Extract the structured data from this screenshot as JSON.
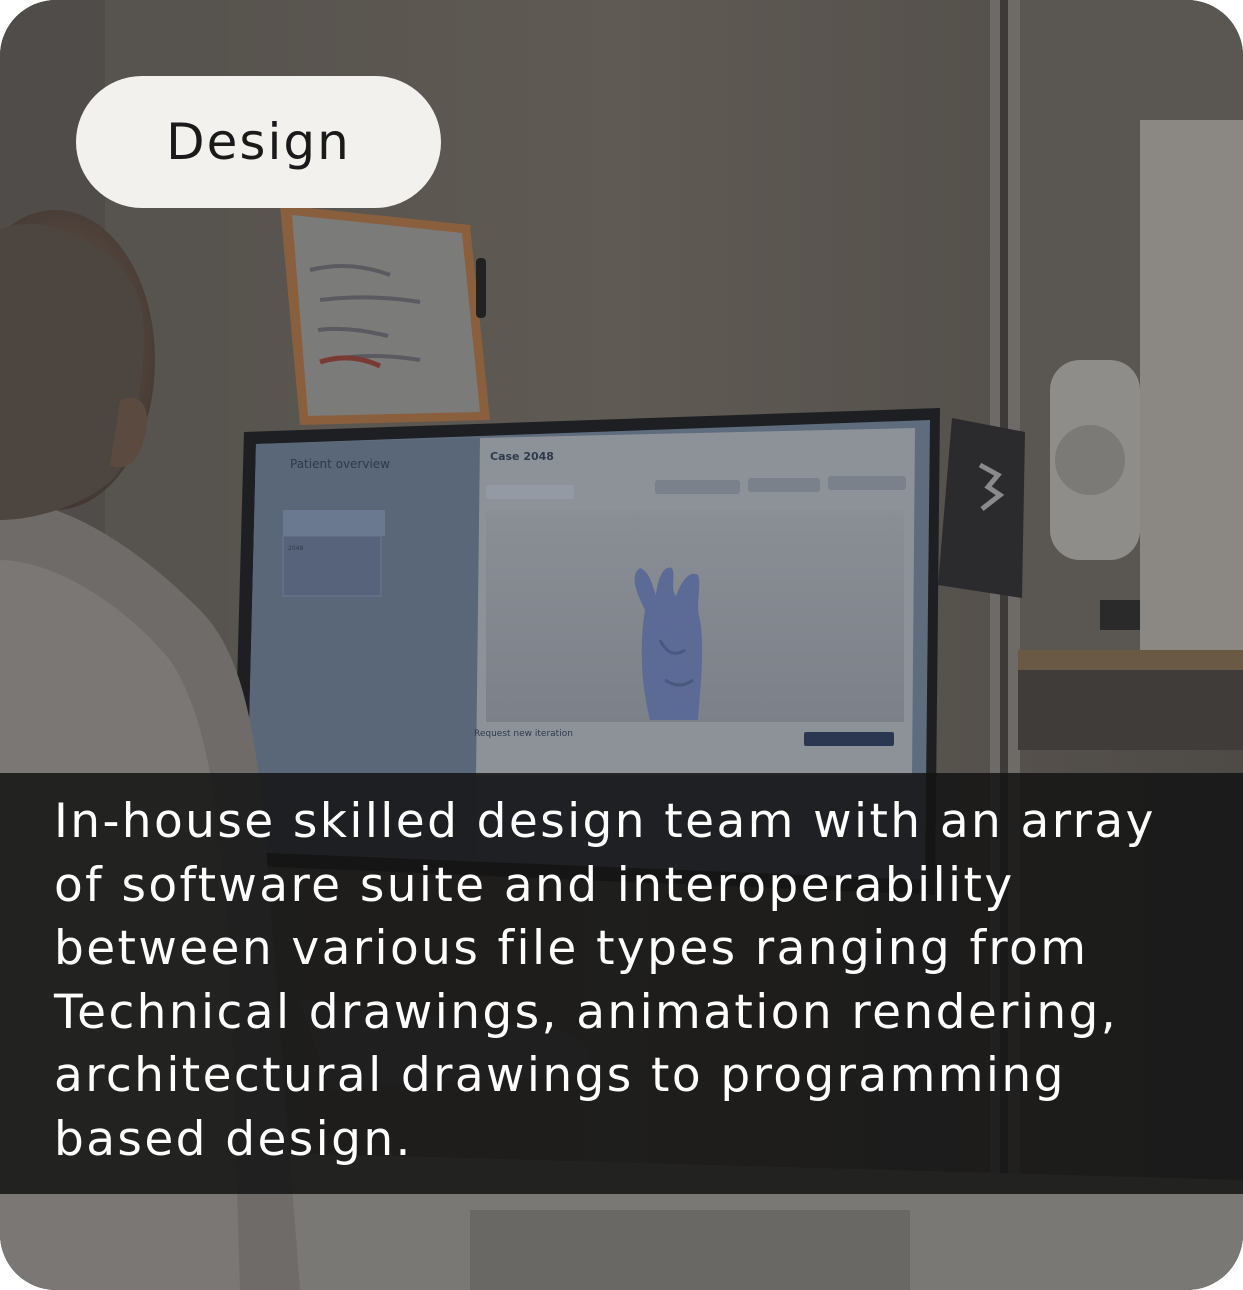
{
  "badge": {
    "label": "Design"
  },
  "caption": {
    "text": "In-house skilled design team with an array of software suite and interoperability between various file types ranging from Technical drawings, animation rendering, architectural drawings to programming based design."
  },
  "screen": {
    "sidebar_title": "Patient overview",
    "case_title": "Case 2048",
    "case_id": "2048",
    "request_label": "Request new iteration"
  },
  "colors": {
    "caption_bg": "#141414",
    "badge_bg": "#f3f1ee",
    "model_blue": "#7e92c4"
  }
}
